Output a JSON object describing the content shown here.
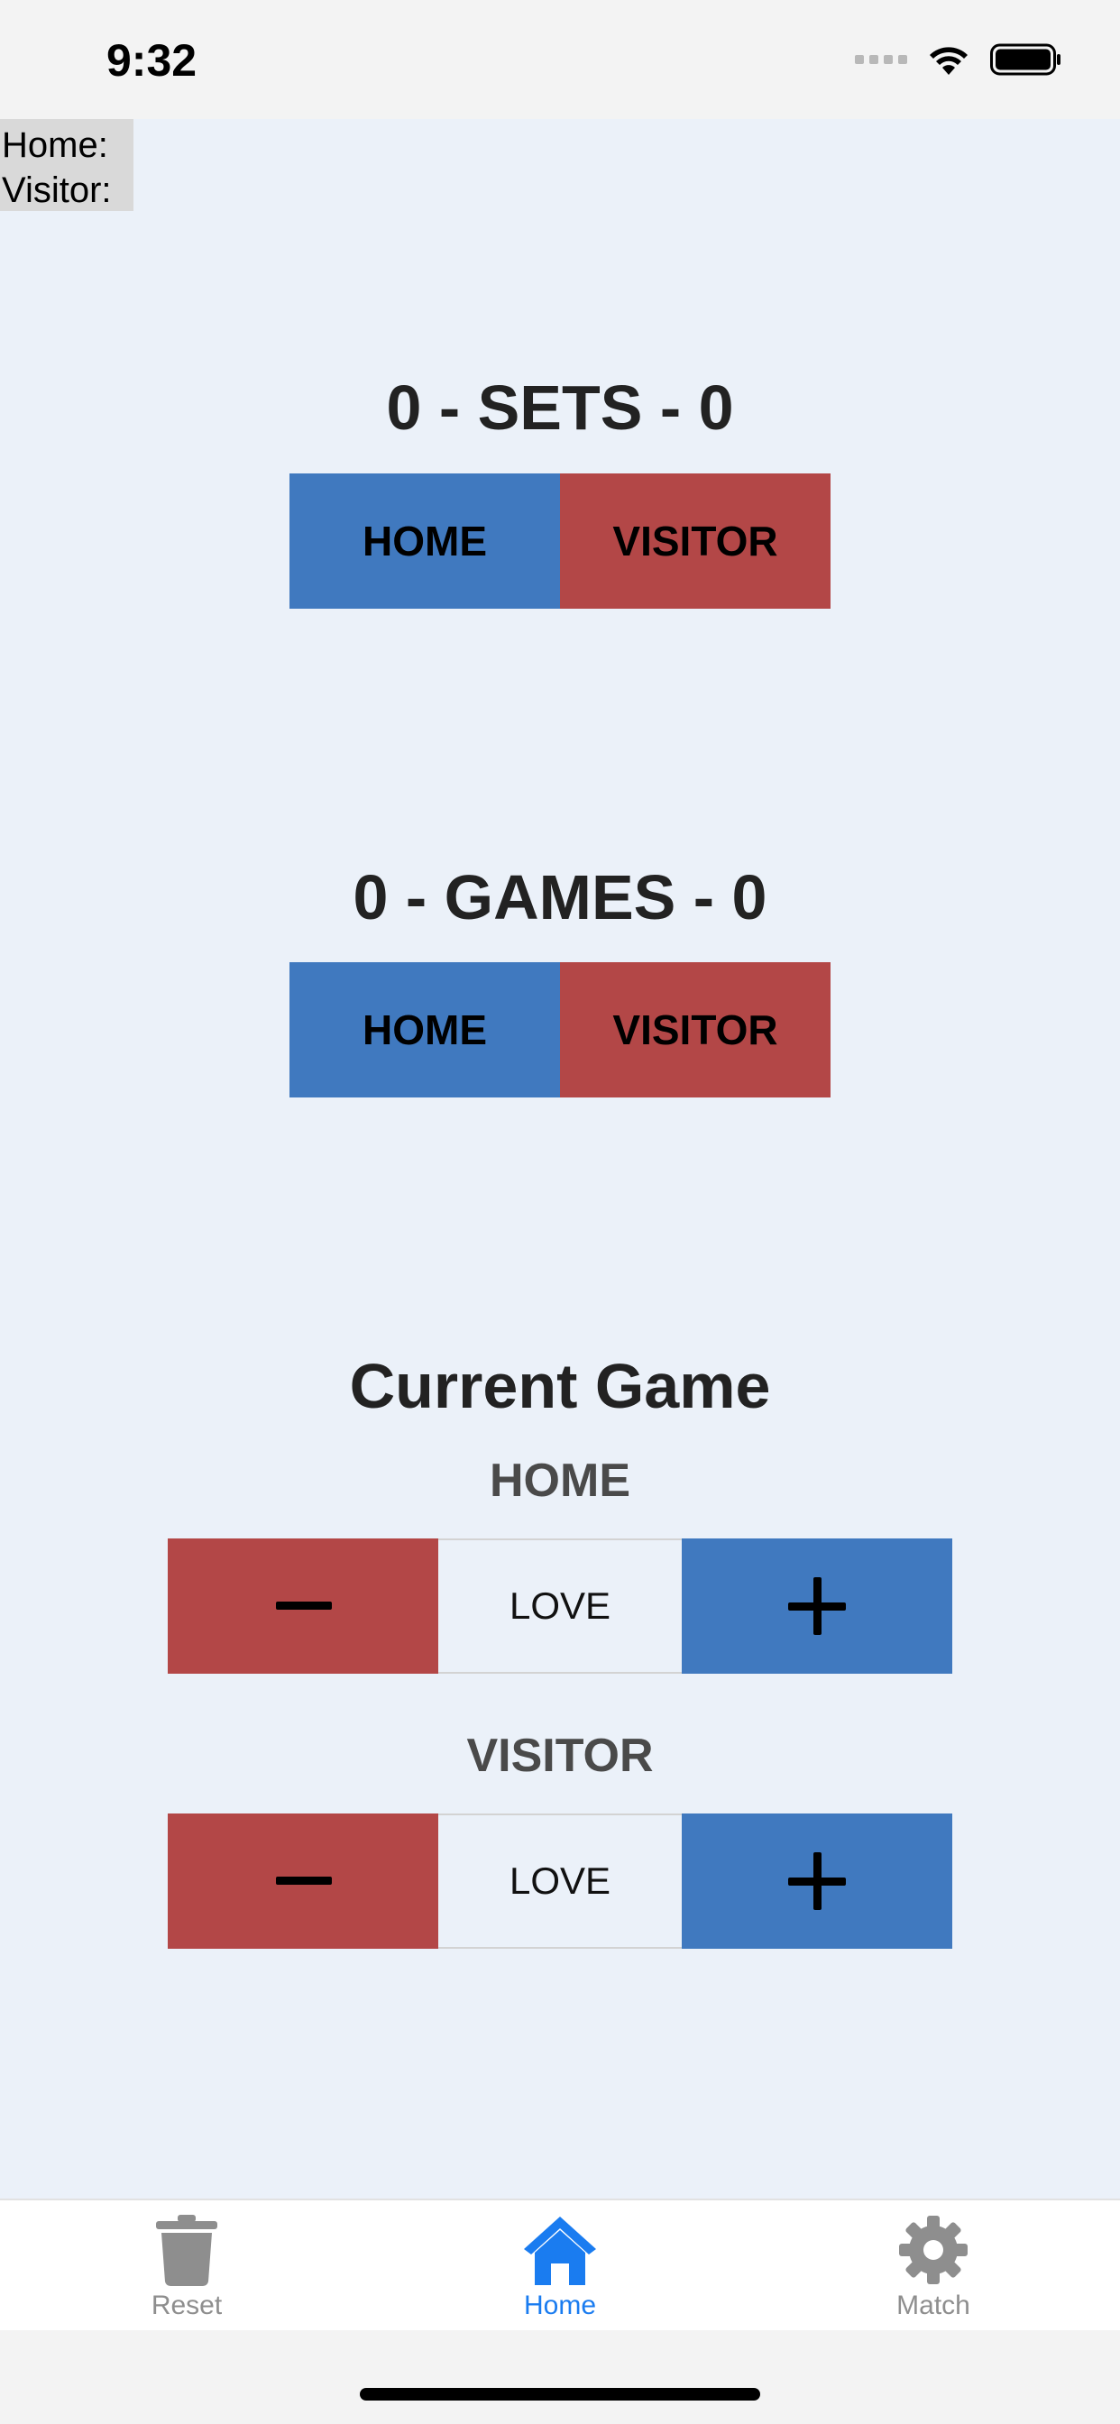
{
  "status_bar": {
    "time": "9:32"
  },
  "names": {
    "home_label": "Home:",
    "visitor_label": "Visitor:"
  },
  "sets": {
    "title": "0 - SETS - 0",
    "home_button": "HOME",
    "visitor_button": "VISITOR"
  },
  "games": {
    "title": "0 - GAMES - 0",
    "home_button": "HOME",
    "visitor_button": "VISITOR"
  },
  "current_game": {
    "title": "Current Game",
    "home": {
      "label": "HOME",
      "score": "LOVE"
    },
    "visitor": {
      "label": "VISITOR",
      "score": "LOVE"
    }
  },
  "tabs": [
    {
      "label": "Reset",
      "icon": "trash-icon",
      "active": false
    },
    {
      "label": "Home",
      "icon": "home-icon",
      "active": true
    },
    {
      "label": "Match",
      "icon": "gear-icon",
      "active": false
    }
  ],
  "colors": {
    "home": "#4079bf",
    "visitor": "#b34747",
    "background": "#ebf1f9",
    "tab_active": "#1a7cf0",
    "tab_inactive": "#8e8e8e"
  }
}
